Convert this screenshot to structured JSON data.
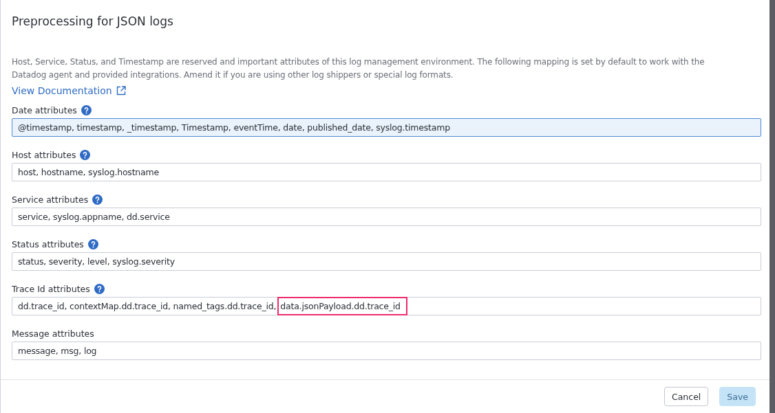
{
  "dialog": {
    "title": "Preprocessing for JSON logs",
    "description": "Host, Service, Status, and Timestamp are reserved and important attributes of this log management environment. The following mapping is set by default to work with the Datadog agent and provided integrations. Amend it if you are using other log shippers or special log formats.",
    "link": "View Documentation",
    "fields": [
      {
        "label": "Date attributes",
        "help": true,
        "focused": true,
        "value_parts": [
          {
            "text": "@timestamp, timestamp, _timestamp, Timestamp, eventTime, date, published_date, syslog.timestamp",
            "highlighted": false
          }
        ]
      },
      {
        "label": "Host attributes",
        "help": true,
        "focused": false,
        "value_parts": [
          {
            "text": "host, hostname, syslog.hostname",
            "highlighted": false
          }
        ]
      },
      {
        "label": "Service attributes",
        "help": true,
        "focused": false,
        "value_parts": [
          {
            "text": "service, syslog.appname, dd.service",
            "highlighted": false
          }
        ]
      },
      {
        "label": "Status attributes",
        "help": true,
        "focused": false,
        "value_parts": [
          {
            "text": "status, severity, level, syslog.severity",
            "highlighted": false
          }
        ]
      },
      {
        "label": "Trace Id attributes",
        "help": true,
        "focused": false,
        "value_parts": [
          {
            "text": "dd.trace_id, contextMap.dd.trace_id, named_tags.dd.trace_id,",
            "highlighted": false
          },
          {
            "text": "data.jsonPayload.dd.trace_id",
            "highlighted": true
          }
        ]
      },
      {
        "label": "Message attributes",
        "help": false,
        "focused": false,
        "value_parts": [
          {
            "text": "message, msg, log",
            "highlighted": false
          }
        ]
      }
    ],
    "buttons": [
      {
        "label": "Cancel",
        "kind": "secondary",
        "disabled": false
      },
      {
        "label": "Save",
        "kind": "primary",
        "disabled": true
      }
    ]
  }
}
